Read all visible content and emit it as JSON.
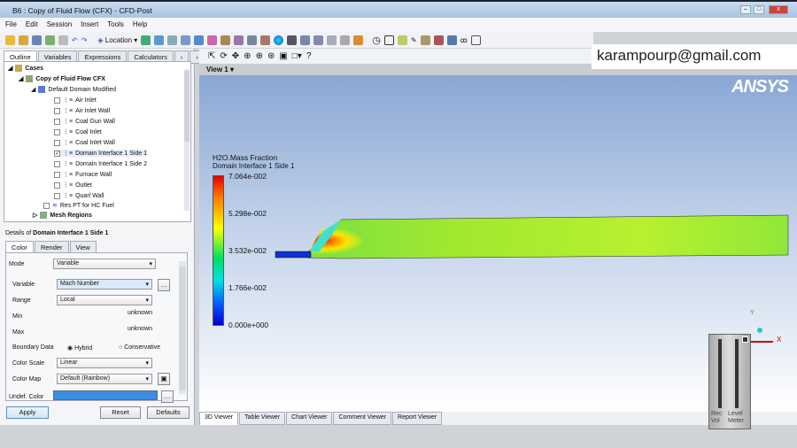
{
  "window": {
    "title": "B6 : Copy of Fluid Flow (CFX) - CFD-Post"
  },
  "menu": [
    "File",
    "Edit",
    "Session",
    "Insert",
    "Tools",
    "Help"
  ],
  "toolbar": {
    "location_label": "Location"
  },
  "overlay": {
    "email": "karampourp@gmail.com"
  },
  "left_tabs": [
    "Outline",
    "Variables",
    "Expressions",
    "Calculators"
  ],
  "tree": {
    "cases": "Cases",
    "case": "Copy of Fluid Flow CFX",
    "domain": "Default Domain Modified",
    "items": [
      {
        "label": "Air Inlet",
        "checked": false
      },
      {
        "label": "Air Inlet Wall",
        "checked": false
      },
      {
        "label": "Coal Gun Wall",
        "checked": false
      },
      {
        "label": "Coal Inlet",
        "checked": false
      },
      {
        "label": "Coal Inlet Wall",
        "checked": false
      },
      {
        "label": "Domain Interface 1 Side 1",
        "checked": true
      },
      {
        "label": "Domain Interface 1 Side 2",
        "checked": false
      },
      {
        "label": "Furnace Wall",
        "checked": false
      },
      {
        "label": "Outlet",
        "checked": false
      },
      {
        "label": "Quarl Wall",
        "checked": false
      }
    ],
    "res": "Res PT for HC Fuel",
    "mesh": "Mesh Regions"
  },
  "details": {
    "prefix": "Details of",
    "object": "Domain Interface 1 Side 1",
    "tabs": [
      "Color",
      "Render",
      "View"
    ],
    "mode_label": "Mode",
    "mode": "Variable",
    "variable_label": "Variable",
    "variable": "Mach Number",
    "range_label": "Range",
    "range": "Local",
    "min_label": "Min",
    "min": "unknown",
    "max_label": "Max",
    "max": "unknown",
    "boundary_label": "Boundary Data",
    "hybrid": "Hybrid",
    "conservative": "Conservative",
    "scale_label": "Color Scale",
    "scale": "Linear",
    "map_label": "Color Map",
    "map": "Default (Rainbow)",
    "undef_label": "Undef. Color",
    "undef_color": "#3a8ee6",
    "apply": "Apply",
    "reset": "Reset",
    "defaults": "Defaults"
  },
  "viewer": {
    "view_label": "View 1",
    "logo": "ANSYS",
    "legend": {
      "title": "H2O.Mass Fraction",
      "subtitle": "Domain Interface 1 Side 1",
      "ticks": [
        "7.064e-002",
        "5.298e-002",
        "3.532e-002",
        "1.766e-002",
        "0.000e+000"
      ]
    },
    "mixer": {
      "rec": "Rec Vol",
      "level": "Level Meter"
    },
    "axis": {
      "x": "X",
      "y": "Y"
    },
    "tabs": [
      "3D Viewer",
      "Table Viewer",
      "Chart Viewer",
      "Comment Viewer",
      "Report Viewer"
    ]
  }
}
